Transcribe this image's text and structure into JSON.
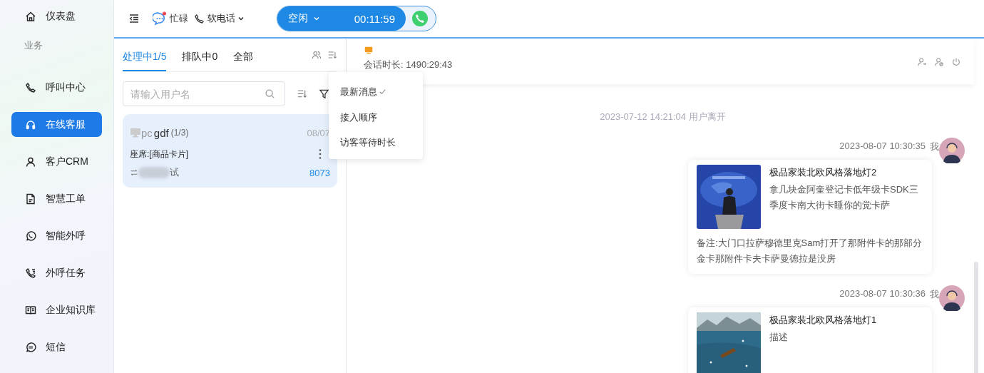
{
  "sidebar": {
    "items": [
      {
        "label": "仪表盘",
        "selected": false
      },
      {
        "label": "业务",
        "kind": "section"
      },
      {
        "label": "呼叫中心",
        "selected": false
      },
      {
        "label": "在线客服",
        "selected": true
      },
      {
        "label": "客户CRM",
        "selected": false
      },
      {
        "label": "智慧工单",
        "selected": false
      },
      {
        "label": "智能外呼",
        "selected": false
      },
      {
        "label": "外呼任务",
        "selected": false
      },
      {
        "label": "企业知识库",
        "selected": false
      },
      {
        "label": "短信",
        "selected": false
      }
    ]
  },
  "topbar": {
    "status": "忙碌",
    "phone": "软电话",
    "call_state": "空闲",
    "call_timer": "00:11:59"
  },
  "tabs": [
    {
      "label": "处理中1/5",
      "selected": true
    },
    {
      "label": "排队中0",
      "selected": false
    },
    {
      "label": "全部",
      "selected": false
    }
  ],
  "search": {
    "placeholder": "请输入用户名"
  },
  "sort_menu": [
    {
      "label": "最新消息",
      "checked": true
    },
    {
      "label": "接入顺序",
      "checked": false
    },
    {
      "label": "访客等待时长",
      "checked": false
    }
  ],
  "sessions": [
    {
      "device": "pc",
      "name": "gdf",
      "count": "(1/3)",
      "date": "08/07",
      "seat": "座席:[商品卡片]",
      "agent": "试",
      "id": "8073",
      "selected": true
    }
  ],
  "chat": {
    "duration": "会话时长: 1490:29:43",
    "messages": [
      {
        "kind": "system",
        "text": "2023-07-12 14:21:04 用户离开"
      },
      {
        "kind": "card",
        "time": "2023-08-07 10:30:35",
        "sender": "我",
        "title": "极品家装北欧风格落地灯2",
        "desc": "拿几块金阿奎登记卡低年级卡SDK三季度卡南大街卡睡你的觉卡萨",
        "note": "备注:大门口拉萨穆德里克Sam打开了那附件卡的那部分金卡那附件卡夫卡萨曼德拉是没房"
      },
      {
        "kind": "card",
        "time": "2023-08-07 10:30:36",
        "sender": "我",
        "title": "极品家装北欧风格落地灯1",
        "desc": "描述"
      }
    ]
  }
}
